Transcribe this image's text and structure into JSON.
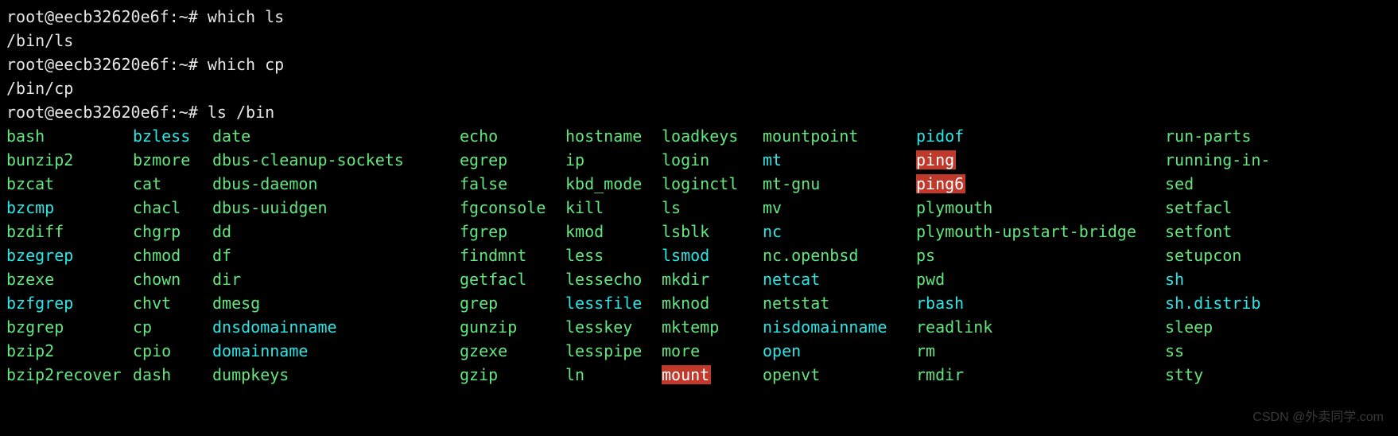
{
  "lines": {
    "p1": "root@eecb32620e6f:~# ",
    "c1": "which ls",
    "o1": "/bin/ls",
    "p2": "root@eecb32620e6f:~# ",
    "c2": "which cp",
    "o2": "/bin/cp",
    "p3": "root@eecb32620e6f:~# ",
    "c3": "ls /bin"
  },
  "columns": [
    [
      {
        "t": "bash",
        "c": "green"
      },
      {
        "t": "bunzip2",
        "c": "green"
      },
      {
        "t": "bzcat",
        "c": "green"
      },
      {
        "t": "bzcmp",
        "c": "cyan"
      },
      {
        "t": "bzdiff",
        "c": "green"
      },
      {
        "t": "bzegrep",
        "c": "cyan"
      },
      {
        "t": "bzexe",
        "c": "green"
      },
      {
        "t": "bzfgrep",
        "c": "cyan"
      },
      {
        "t": "bzgrep",
        "c": "green"
      },
      {
        "t": "bzip2",
        "c": "green"
      },
      {
        "t": "bzip2recover",
        "c": "green"
      }
    ],
    [
      {
        "t": "bzless",
        "c": "cyan"
      },
      {
        "t": "bzmore",
        "c": "green"
      },
      {
        "t": "cat",
        "c": "green"
      },
      {
        "t": "chacl",
        "c": "green"
      },
      {
        "t": "chgrp",
        "c": "green"
      },
      {
        "t": "chmod",
        "c": "green"
      },
      {
        "t": "chown",
        "c": "green"
      },
      {
        "t": "chvt",
        "c": "green"
      },
      {
        "t": "cp",
        "c": "green"
      },
      {
        "t": "cpio",
        "c": "green"
      },
      {
        "t": "dash",
        "c": "green"
      }
    ],
    [
      {
        "t": "date",
        "c": "green"
      },
      {
        "t": "dbus-cleanup-sockets",
        "c": "green"
      },
      {
        "t": "dbus-daemon",
        "c": "green"
      },
      {
        "t": "dbus-uuidgen",
        "c": "green"
      },
      {
        "t": "dd",
        "c": "green"
      },
      {
        "t": "df",
        "c": "green"
      },
      {
        "t": "dir",
        "c": "green"
      },
      {
        "t": "dmesg",
        "c": "green"
      },
      {
        "t": "dnsdomainname",
        "c": "cyan"
      },
      {
        "t": "domainname",
        "c": "cyan"
      },
      {
        "t": "dumpkeys",
        "c": "green"
      }
    ],
    [
      {
        "t": "echo",
        "c": "green"
      },
      {
        "t": "egrep",
        "c": "green"
      },
      {
        "t": "false",
        "c": "green"
      },
      {
        "t": "fgconsole",
        "c": "green"
      },
      {
        "t": "fgrep",
        "c": "green"
      },
      {
        "t": "findmnt",
        "c": "green"
      },
      {
        "t": "getfacl",
        "c": "green"
      },
      {
        "t": "grep",
        "c": "green"
      },
      {
        "t": "gunzip",
        "c": "green"
      },
      {
        "t": "gzexe",
        "c": "green"
      },
      {
        "t": "gzip",
        "c": "green"
      }
    ],
    [
      {
        "t": "hostname",
        "c": "green"
      },
      {
        "t": "ip",
        "c": "green"
      },
      {
        "t": "kbd_mode",
        "c": "green"
      },
      {
        "t": "kill",
        "c": "green"
      },
      {
        "t": "kmod",
        "c": "green"
      },
      {
        "t": "less",
        "c": "green"
      },
      {
        "t": "lessecho",
        "c": "green"
      },
      {
        "t": "lessfile",
        "c": "cyan"
      },
      {
        "t": "lesskey",
        "c": "green"
      },
      {
        "t": "lesspipe",
        "c": "green"
      },
      {
        "t": "ln",
        "c": "green"
      }
    ],
    [
      {
        "t": "loadkeys",
        "c": "green"
      },
      {
        "t": "login",
        "c": "green"
      },
      {
        "t": "loginctl",
        "c": "green"
      },
      {
        "t": "ls",
        "c": "green"
      },
      {
        "t": "lsblk",
        "c": "green"
      },
      {
        "t": "lsmod",
        "c": "cyan"
      },
      {
        "t": "mkdir",
        "c": "green"
      },
      {
        "t": "mknod",
        "c": "green"
      },
      {
        "t": "mktemp",
        "c": "green"
      },
      {
        "t": "more",
        "c": "green"
      },
      {
        "t": "mount",
        "c": "hl"
      }
    ],
    [
      {
        "t": "mountpoint",
        "c": "green"
      },
      {
        "t": "mt",
        "c": "cyan"
      },
      {
        "t": "mt-gnu",
        "c": "green"
      },
      {
        "t": "mv",
        "c": "green"
      },
      {
        "t": "nc",
        "c": "cyan"
      },
      {
        "t": "nc.openbsd",
        "c": "green"
      },
      {
        "t": "netcat",
        "c": "cyan"
      },
      {
        "t": "netstat",
        "c": "green"
      },
      {
        "t": "nisdomainname",
        "c": "cyan"
      },
      {
        "t": "open",
        "c": "cyan"
      },
      {
        "t": "openvt",
        "c": "green"
      }
    ],
    [
      {
        "t": "pidof",
        "c": "cyan"
      },
      {
        "t": "ping",
        "c": "hl"
      },
      {
        "t": "ping6",
        "c": "hl"
      },
      {
        "t": "plymouth",
        "c": "green"
      },
      {
        "t": "plymouth-upstart-bridge",
        "c": "green"
      },
      {
        "t": "ps",
        "c": "green"
      },
      {
        "t": "pwd",
        "c": "green"
      },
      {
        "t": "rbash",
        "c": "cyan"
      },
      {
        "t": "readlink",
        "c": "green"
      },
      {
        "t": "rm",
        "c": "green"
      },
      {
        "t": "rmdir",
        "c": "green"
      }
    ],
    [
      {
        "t": "run-parts",
        "c": "green"
      },
      {
        "t": "running-in-",
        "c": "green"
      },
      {
        "t": "sed",
        "c": "green"
      },
      {
        "t": "setfacl",
        "c": "green"
      },
      {
        "t": "setfont",
        "c": "green"
      },
      {
        "t": "setupcon",
        "c": "green"
      },
      {
        "t": "sh",
        "c": "cyan"
      },
      {
        "t": "sh.distrib",
        "c": "cyan"
      },
      {
        "t": "sleep",
        "c": "green"
      },
      {
        "t": "ss",
        "c": "green"
      },
      {
        "t": "stty",
        "c": "green"
      }
    ]
  ],
  "watermark": "CSDN @外卖同学.com"
}
